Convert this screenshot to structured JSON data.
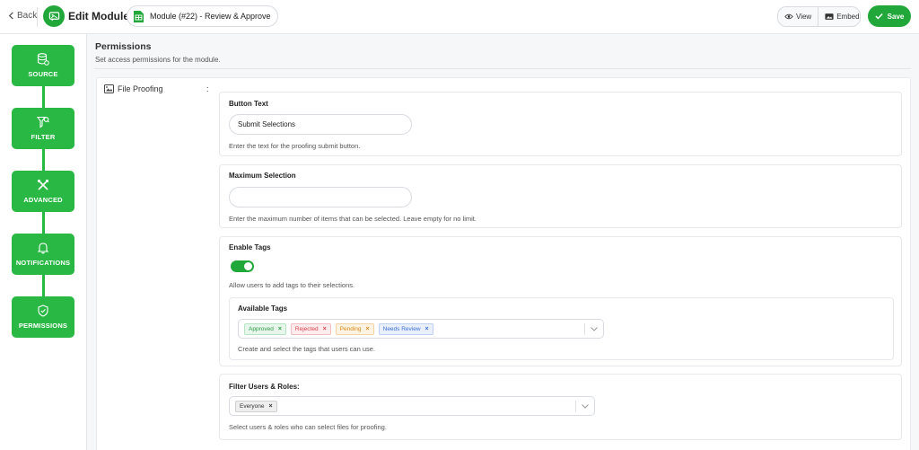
{
  "header": {
    "back_label": "Back",
    "title": "Edit Module",
    "module_name": "Module (#22) - Review & Approve",
    "view_label": "View",
    "embed_label": "Embed",
    "save_label": "Save"
  },
  "sidebar": {
    "steps": [
      {
        "label": "SOURCE",
        "icon": "database-icon"
      },
      {
        "label": "FILTER",
        "icon": "filter-icon"
      },
      {
        "label": "ADVANCED",
        "icon": "tools-icon"
      },
      {
        "label": "NOTIFICATIONS",
        "icon": "bell-icon"
      },
      {
        "label": "PERMISSIONS",
        "icon": "shield-check-icon"
      }
    ]
  },
  "main": {
    "title": "Permissions",
    "subtitle": "Set access permissions for the module.",
    "section_label": "File Proofing",
    "colon": ":",
    "button_text": {
      "label": "Button Text",
      "value": "Submit Selections",
      "help": "Enter the text for the proofing submit button."
    },
    "max_selection": {
      "label": "Maximum Selection",
      "value": "",
      "help": "Enter the maximum number of items that can be selected. Leave empty for no limit."
    },
    "enable_tags": {
      "label": "Enable Tags",
      "enabled": true,
      "help": "Allow users to add tags to their selections."
    },
    "available_tags": {
      "label": "Available Tags",
      "tags": [
        {
          "label": "Approved",
          "color": "#2e9a45",
          "bg": "#e8f7ec",
          "border": "#b7e3c2"
        },
        {
          "label": "Rejected",
          "color": "#d6424b",
          "bg": "#fdecee",
          "border": "#f3bcc0"
        },
        {
          "label": "Pending",
          "color": "#d68a19",
          "bg": "#fdf3e3",
          "border": "#f1d3a4"
        },
        {
          "label": "Needs Review",
          "color": "#3b6fd1",
          "bg": "#e9f0fc",
          "border": "#bcd0f2"
        }
      ],
      "help": "Create and select the tags that users can use."
    },
    "filter_users": {
      "label": "Filter Users & Roles:",
      "tags": [
        {
          "label": "Everyone",
          "color": "#333333",
          "bg": "#eeeeee",
          "border": "#cfcfcf"
        }
      ],
      "help": "Select users & roles who can select files for proofing."
    }
  },
  "colors": {
    "accent": "#22a83a",
    "step_green": "#2ab845"
  }
}
